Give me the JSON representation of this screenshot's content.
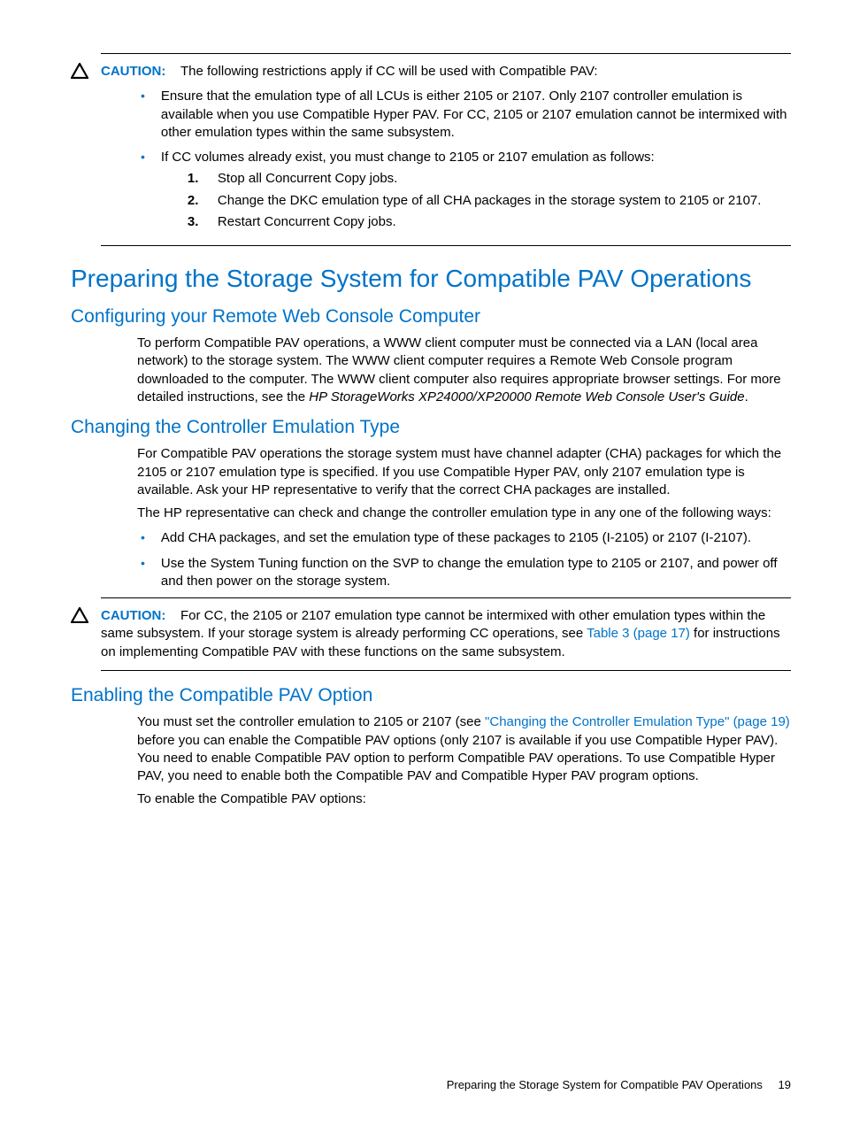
{
  "caution1": {
    "label": "CAUTION:",
    "text": "The following restrictions apply if CC will be used with Compatible PAV:",
    "bullets": [
      "Ensure that the emulation type of all LCUs is either 2105 or 2107. Only 2107 controller emulation is available when you use Compatible Hyper PAV. For CC, 2105 or 2107 emulation cannot be intermixed with other emulation types within the same subsystem.",
      "If CC volumes already exist, you must change to 2105 or 2107 emulation as follows:"
    ],
    "steps": [
      "Stop all Concurrent Copy jobs.",
      "Change the DKC emulation type of all CHA packages in the storage system to 2105 or 2107.",
      "Restart Concurrent Copy jobs."
    ]
  },
  "h1": "Preparing the Storage System for Compatible PAV Operations",
  "sec1": {
    "title": "Configuring your Remote Web Console Computer",
    "p1a": "To perform Compatible PAV operations, a WWW client computer must be connected via a LAN (local area network) to the storage system. The WWW client computer requires a Remote Web Console program downloaded to the computer. The WWW client computer also requires appropriate browser settings. For more detailed instructions, see the ",
    "p1i": "HP StorageWorks XP24000/XP20000 Remote Web Console User's Guide",
    "p1b": "."
  },
  "sec2": {
    "title": "Changing the Controller Emulation Type",
    "p1": "For Compatible PAV operations the storage system must have channel adapter (CHA) packages for which the 2105 or 2107 emulation type is specified. If you use Compatible Hyper PAV, only 2107 emulation type is available. Ask your HP representative to verify that the correct CHA packages are installed.",
    "p2": "The HP representative can check and change the controller emulation type in any one of the following ways:",
    "bullets": [
      "Add CHA packages, and set the emulation type of these packages to 2105 (I-2105) or 2107 (I-2107).",
      "Use the System Tuning function on the SVP to change the emulation type to 2105 or 2107, and power off and then power on the storage system."
    ]
  },
  "caution2": {
    "label": "CAUTION:",
    "textA": "For CC, the 2105 or 2107 emulation type cannot be intermixed with other emulation types within the same subsystem. If your storage system is already performing CC operations, see ",
    "link": "Table 3 (page 17)",
    "textB": " for instructions on implementing Compatible PAV with these functions on the same subsystem."
  },
  "sec3": {
    "title": "Enabling the Compatible PAV Option",
    "p1a": "You must set the controller emulation to 2105 or 2107 (see ",
    "link": "\"Changing the Controller Emulation Type\" (page 19)",
    "p1b": " before you can enable the Compatible PAV options (only 2107 is available if you use Compatible Hyper PAV). You need to enable Compatible PAV option to perform Compatible PAV operations. To use Compatible Hyper PAV, you need to enable both the Compatible PAV and Compatible Hyper PAV program options.",
    "p2": "To enable the Compatible PAV options:"
  },
  "footer": {
    "text": "Preparing the Storage System for Compatible PAV Operations",
    "page": "19"
  }
}
